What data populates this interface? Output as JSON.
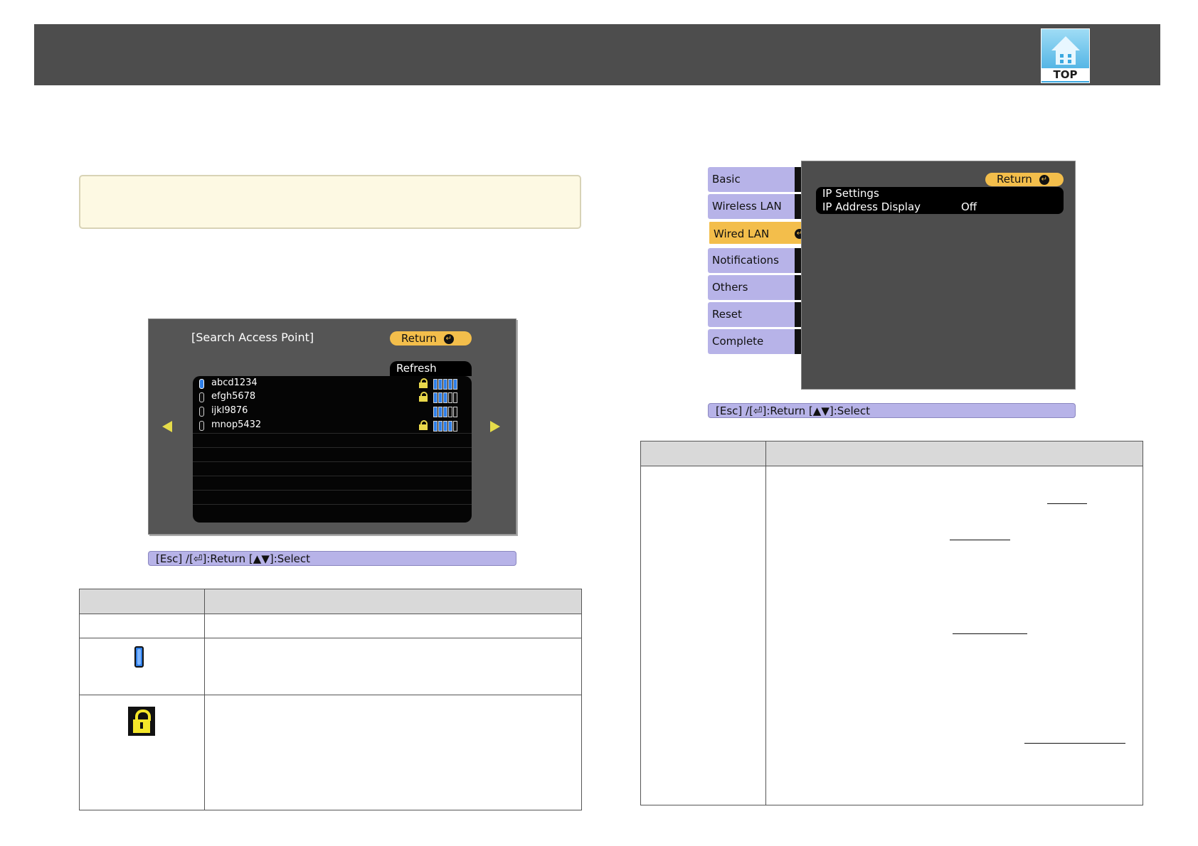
{
  "header": {
    "logo_label": "TOP"
  },
  "search_screen": {
    "title": "[Search Access Point]",
    "return_label": "Return",
    "refresh_label": "Refresh",
    "access_points": [
      {
        "name": "abcd1234",
        "selected": true,
        "locked": true,
        "signal": 5
      },
      {
        "name": "efgh5678",
        "selected": false,
        "locked": true,
        "signal": 3
      },
      {
        "name": "ijkl9876",
        "selected": false,
        "locked": false,
        "signal": 3
      },
      {
        "name": "mnop5432",
        "selected": false,
        "locked": true,
        "signal": 4
      }
    ],
    "help_bar": "[Esc] /[⏎]:Return  [▲▼]:Select"
  },
  "network_menu": {
    "tabs": [
      {
        "label": "Basic",
        "active": false
      },
      {
        "label": "Wireless LAN",
        "active": false
      },
      {
        "label": "Wired LAN",
        "active": true
      },
      {
        "label": "Notifications",
        "active": false
      },
      {
        "label": "Others",
        "active": false
      },
      {
        "label": "Reset",
        "active": false
      },
      {
        "label": "Complete",
        "active": false
      }
    ],
    "return_label": "Return",
    "items": [
      {
        "label": "IP Settings",
        "value": ""
      },
      {
        "label": "IP Address Display",
        "value": "Off"
      }
    ],
    "help_bar": "[Esc] /[⏎]:Return  [▲▼]:Select"
  },
  "colors": {
    "accent": "#f3be4b",
    "menu_tab": "#b7b3e8",
    "header": "#4d4d4d"
  }
}
